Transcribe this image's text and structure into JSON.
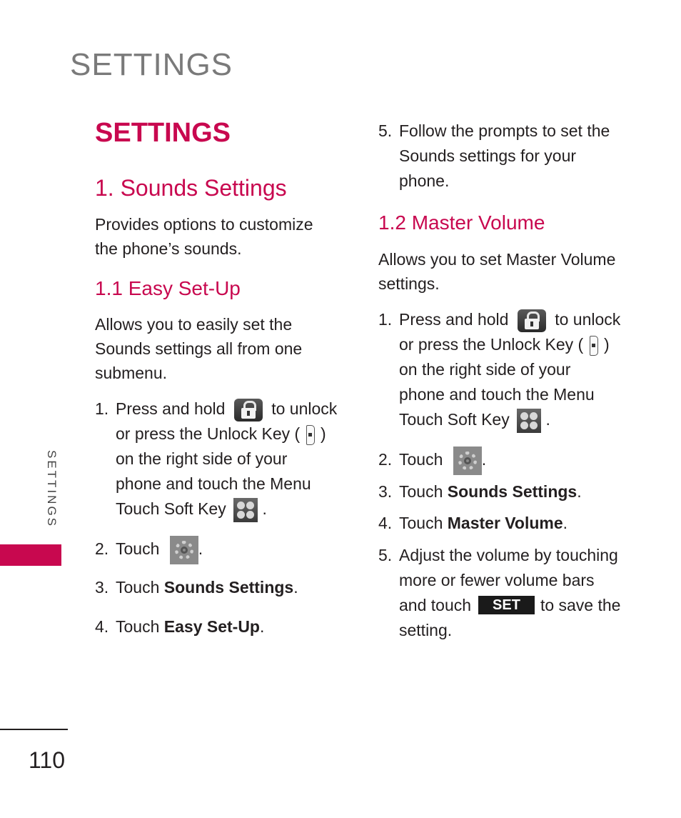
{
  "running_head": "SETTINGS",
  "side_tab": {
    "label": "SETTINGS",
    "accent_color": "#c8084f"
  },
  "page_number": "110",
  "left_column": {
    "chapter_title": "SETTINGS",
    "section_title": "1. Sounds Settings",
    "section_intro": [
      "Provides options to customize",
      "the phone’s sounds."
    ],
    "subsection_title": "1.1 Easy Set-Up",
    "subsection_intro": [
      "Allows you to easily set the",
      "Sounds settings all from one",
      "submenu."
    ],
    "steps": {
      "s1": {
        "num": "1.",
        "a": "Press and hold",
        "b": "to unlock",
        "l2a": "or press the Unlock Key (",
        "l2b": ")",
        "l3": "on the right side of your",
        "l4": "phone and touch the Menu",
        "l5": "Touch Soft Key",
        "l5end": "."
      },
      "s2": {
        "num": "2.",
        "text": "Touch",
        "end": "."
      },
      "s3": {
        "num": "3.",
        "text": "Touch",
        "bold": "Sounds Settings",
        "end": "."
      },
      "s4": {
        "num": "4.",
        "text": "Touch",
        "bold": "Easy Set-Up",
        "end": "."
      }
    }
  },
  "right_column": {
    "step5_prev": {
      "num": "5.",
      "lines": [
        "Follow the prompts to set the",
        "Sounds settings for your",
        "phone."
      ]
    },
    "subsection_title": "1.2 Master Volume",
    "subsection_intro": [
      "Allows you to set Master Volume",
      "settings."
    ],
    "steps": {
      "s1": {
        "num": "1.",
        "a": "Press and hold",
        "b": "to unlock",
        "l2a": "or press the Unlock Key (",
        "l2b": ")",
        "l3": "on the right side of your",
        "l4": "phone and touch the Menu",
        "l5": "Touch Soft Key",
        "l5end": "."
      },
      "s2": {
        "num": "2.",
        "text": "Touch",
        "end": "."
      },
      "s3": {
        "num": "3.",
        "text": "Touch",
        "bold": "Sounds Settings",
        "end": "."
      },
      "s4": {
        "num": "4.",
        "text": "Touch",
        "bold": "Master Volume",
        "end": "."
      },
      "s5": {
        "num": "5.",
        "l1": "Adjust the volume by touching",
        "l2": "more or fewer volume bars",
        "l3a": "and touch",
        "button": "SET",
        "l3b": "to save the",
        "l4": "setting."
      }
    }
  },
  "icons": {
    "lock": "lock-icon",
    "unlock_key": "side-key-icon",
    "menu": "menu-soft-key-icon",
    "settings": "gear-icon"
  }
}
